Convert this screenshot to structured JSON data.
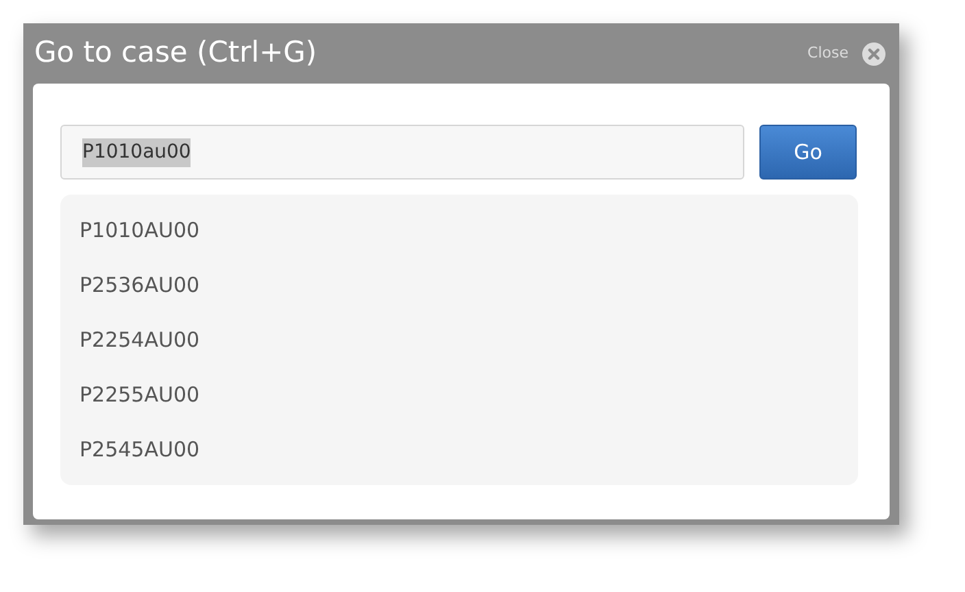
{
  "dialog": {
    "title": "Go to case (Ctrl+G)",
    "close_label": "Close"
  },
  "search": {
    "value": "P1010au00",
    "value_selected": true
  },
  "go_button": {
    "label": "Go"
  },
  "results": [
    {
      "label": "P1010AU00"
    },
    {
      "label": "P2536AU00"
    },
    {
      "label": "P2254AU00"
    },
    {
      "label": "P2255AU00"
    },
    {
      "label": "P2545AU00"
    }
  ]
}
